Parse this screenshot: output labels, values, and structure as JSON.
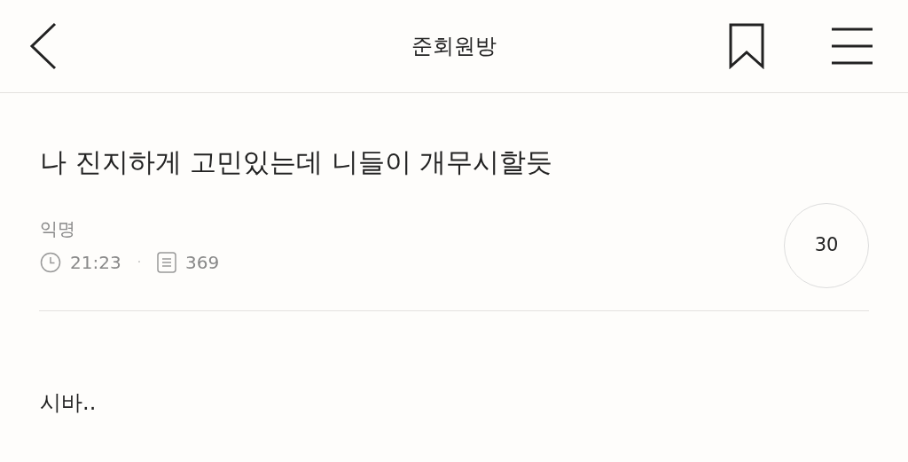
{
  "header": {
    "title": "준회원방"
  },
  "post": {
    "title": "나 진지하게 고민있는데 니들이 개무시할듯",
    "author": "익명",
    "time": "21:23",
    "separator": "·",
    "views": "369",
    "comments": "30",
    "body": "시바.."
  }
}
